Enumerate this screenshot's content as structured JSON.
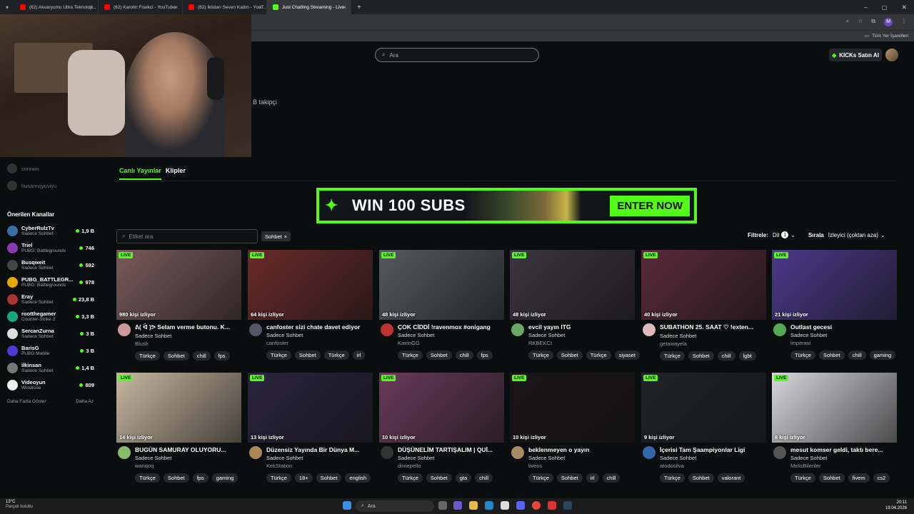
{
  "browser": {
    "tabs": [
      {
        "label": "(62) Akvaryumu Ultra Teknoloji...",
        "color": "#ff0000"
      },
      {
        "label": "(62) Karolin Fisekci - YouTube",
        "color": "#ff0000"
      },
      {
        "label": "(62) İktidarı Seven Kadın - YouT...",
        "color": "#ff0000"
      },
      {
        "label": "Just Chatting Streaming - Live",
        "color": "#53fc18"
      }
    ],
    "bookmarks_label": "Tüm Yer İşaretleri"
  },
  "header": {
    "search_placeholder": "Ara",
    "kicks_button": "KICKs Satın Al"
  },
  "profile": {
    "followers_text": "B takipçi"
  },
  "sidebar": {
    "following": [
      {
        "name": "sonrain"
      },
      {
        "name": "husamvjyuviyu"
      }
    ],
    "recommended_heading": "Önerilen Kanallar",
    "channels": [
      {
        "name": "CyberRulzTv",
        "category": "Sadece Sohbet",
        "viewers": "1,9 B",
        "color": "#3a6ea5"
      },
      {
        "name": "Triel",
        "category": "PUBG: Battlegrounds",
        "viewers": "746",
        "color": "#8a3ab0"
      },
      {
        "name": "Busqweit",
        "category": "Sadece Sohbet",
        "viewers": "592",
        "color": "#444"
      },
      {
        "name": "PUBG_BATTLEGR...",
        "category": "PUBG: Battlegrounds",
        "viewers": "978",
        "color": "#e5a800"
      },
      {
        "name": "Eray",
        "category": "Sadece Sohbet",
        "viewers": "23,8 B",
        "color": "#a33"
      },
      {
        "name": "rootthegamer",
        "category": "Counter-Strike 2",
        "viewers": "3,3 B",
        "color": "#1aa87a"
      },
      {
        "name": "SercanZurna",
        "category": "Sadece Sohbet",
        "viewers": "3 B",
        "color": "#ddd"
      },
      {
        "name": "BarisG",
        "category": "PUBG Mobile",
        "viewers": "3 B",
        "color": "#4a3ad0"
      },
      {
        "name": "ilkinsan",
        "category": "Sadece Sohbet",
        "viewers": "1,4 B",
        "color": "#777"
      },
      {
        "name": "Videoyun",
        "category": "Windrose",
        "viewers": "809",
        "color": "#eee"
      }
    ],
    "show_more": "Daha Fazla Göster",
    "show_less": "Daha Az"
  },
  "main": {
    "tabs": [
      "Canlı Yayınlar",
      "Klipler"
    ],
    "banner": {
      "headline": "WIN 100 SUBS",
      "cta": "ENTER NOW"
    },
    "tag_search_placeholder": "Etiket ara",
    "active_chip": "Sohbet",
    "filter_label": "Filtrele:",
    "language_label": "Dil",
    "language_count": "1",
    "sort_label": "Sırala",
    "sort_value": "İzleyici (çoktan aza)",
    "live_badge": "LIVE",
    "streams": [
      {
        "viewers": "980 kişi izliyor",
        "title": "ᕕ( ᐛ )ᕗ Selam verme butonu. K...",
        "category": "Sadece Sohbet",
        "user": "Blush",
        "tags": [
          "Türkçe",
          "Sohbet",
          "chill",
          "fps"
        ],
        "thumb": "#7a5a5a",
        "avatar": "#c99"
      },
      {
        "viewers": "64 kişi izliyor",
        "title": "canfoster sizi chate davet ediyor",
        "category": "Sadece Sohbet",
        "user": "canfoster",
        "tags": [
          "Türkçe",
          "Sohbet",
          "Türkçe",
          "irl"
        ],
        "thumb": "#6a2a2a",
        "avatar": "#556"
      },
      {
        "viewers": "48 kişi izliyor",
        "title": "ÇOK CİDDİ !ravenmox #onigang",
        "category": "Sadece Sohbet",
        "user": "KairinGG",
        "tags": [
          "Türkçe",
          "Sohbet",
          "chill",
          "fps"
        ],
        "thumb": "#555a60",
        "avatar": "#b33"
      },
      {
        "viewers": "48 kişi izliyor",
        "title": "evcil yayın ITG",
        "category": "Sadece Sohbet",
        "user": "RKBEKCI",
        "tags": [
          "Türkçe",
          "Sohbet",
          "Türkçe",
          "siyaset"
        ],
        "thumb": "#3a3540",
        "avatar": "#6a6"
      },
      {
        "viewers": "40 kişi izliyor",
        "title": "SUBATHON 25. SAAT ♡ !exten...",
        "category": "Sadece Sohbet",
        "user": "getawayela",
        "tags": [
          "Türkçe",
          "Sohbet",
          "chill",
          "lgbt"
        ],
        "thumb": "#5a2a3a",
        "avatar": "#dbb"
      },
      {
        "viewers": "21 kişi izliyor",
        "title": "Outlast gecesi",
        "category": "Sadece Sohbet",
        "user": "imperavi",
        "tags": [
          "Türkçe",
          "Sohbet",
          "chill",
          "gaming"
        ],
        "thumb": "#4a3a8a",
        "avatar": "#5a5"
      },
      {
        "viewers": "14 kişi izliyor",
        "title": "BUGÜN SAMURAY OLUYORU...",
        "category": "Sadece Sohbet",
        "user": "wanqoq",
        "tags": [
          "Türkçe",
          "Sohbet",
          "fps",
          "gaming"
        ],
        "thumb": "#c8b8a0",
        "avatar": "#8b6"
      },
      {
        "viewers": "13 kişi izliyor",
        "title": "Düzensiz Yayında Bir Dünya M...",
        "category": "Sadece Sohbet",
        "user": "KekStation",
        "tags": [
          "Türkçe",
          "18+",
          "Sohbet",
          "english"
        ],
        "thumb": "#2a2440",
        "avatar": "#a85"
      },
      {
        "viewers": "10 kişi izliyor",
        "title": "DÜŞÜNELİM TARTIŞALIM | QUİ...",
        "category": "Sadece Sohbet",
        "user": "donepello",
        "tags": [
          "Türkçe",
          "Sohbet",
          "gta",
          "chill"
        ],
        "thumb": "#6a3a5a",
        "avatar": "#333"
      },
      {
        "viewers": "10 kişi izliyor",
        "title": "beklenmeyen o yayın",
        "category": "Sadece Sohbet",
        "user": "liveos",
        "tags": [
          "Türkçe",
          "Sohbet",
          "irl",
          "chill"
        ],
        "thumb": "#1a1618",
        "avatar": "#a86"
      },
      {
        "viewers": "9 kişi izliyor",
        "title": "İçerisi Tam Şaampiyonlar Ligi",
        "category": "Sadece Sohbet",
        "user": "atodosilva",
        "tags": [
          "Türkçe",
          "Sohbet",
          "valorant"
        ],
        "thumb": "#202428",
        "avatar": "#36a"
      },
      {
        "viewers": "8 kişi izliyor",
        "title": "mesut komser geldi, taktı bere...",
        "category": "Sadece Sohbet",
        "user": "MelisBilenler",
        "tags": [
          "Türkçe",
          "Sohbet",
          "fivem",
          "cs2"
        ],
        "thumb": "#d8d8dc",
        "avatar": "#555"
      }
    ]
  },
  "taskbar": {
    "weather_temp": "13°C",
    "weather_desc": "Parçalı bulutlu",
    "search_placeholder": "Ara",
    "time": "20:11",
    "date": "19.04.2026"
  }
}
